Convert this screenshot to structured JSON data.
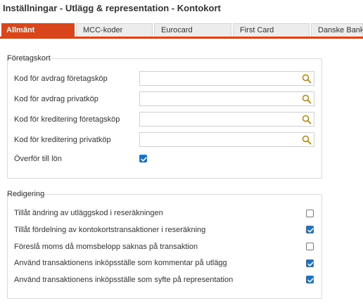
{
  "header": {
    "title": "Inställningar - Utlägg & representation - Kontokort"
  },
  "tabs": [
    {
      "label": "Allmänt",
      "active": true
    },
    {
      "label": "MCC-koder",
      "active": false
    },
    {
      "label": "Eurocard",
      "active": false
    },
    {
      "label": "First Card",
      "active": false
    },
    {
      "label": "Danske Bank",
      "active": false
    }
  ],
  "foretagskort": {
    "legend": "Företagskort",
    "fields": [
      {
        "label": "Kod för avdrag företagsköp",
        "value": "",
        "icon": "search-icon"
      },
      {
        "label": "Kod för avdrag privatköp",
        "value": "",
        "icon": "search-icon"
      },
      {
        "label": "Kod för kreditering företagsköp",
        "value": "",
        "icon": "search-icon"
      },
      {
        "label": "Kod för kreditering privatköp",
        "value": "",
        "icon": "search-icon"
      }
    ],
    "overfor": {
      "label": "Överför till lön",
      "checked": true
    }
  },
  "redigering": {
    "legend": "Redigering",
    "options": [
      {
        "label": "Tillåt ändring av utläggskod i reseräkningen",
        "checked": false
      },
      {
        "label": "Tillåt fördelning av kontokortstransaktioner i reseräkning",
        "checked": true
      },
      {
        "label": "Föreslå moms då momsbelopp saknas på transaktion",
        "checked": false
      },
      {
        "label": "Använd transaktionens inköpsställe som kommentar på utlägg",
        "checked": true
      },
      {
        "label": "Använd transaktionens inköpsställe som syfte på representation",
        "checked": true
      }
    ]
  },
  "colors": {
    "accent": "#d9461c",
    "checkbox": "#1a73c8",
    "search_icon": "#b8860b"
  }
}
